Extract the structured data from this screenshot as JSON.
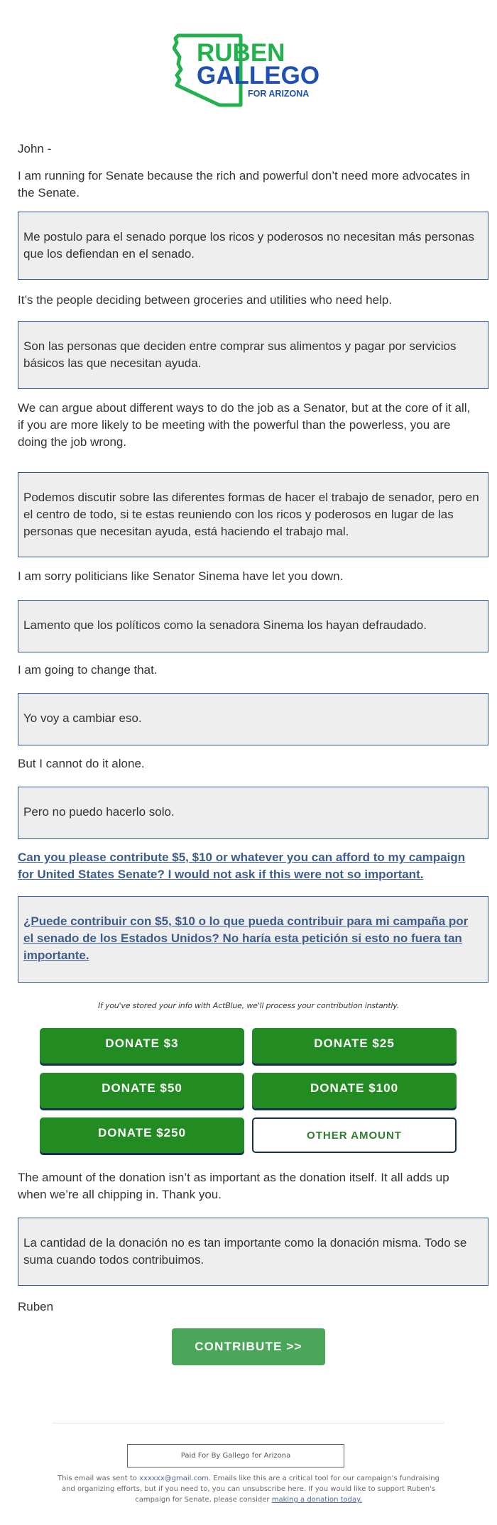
{
  "logo": {
    "line1": "RUBEN",
    "line2": "GALLEGO",
    "line3": "FOR ARIZONA",
    "icon": "arizona-outline-icon",
    "colors": {
      "green": "#22b14c",
      "blue": "#1f4fb3"
    }
  },
  "greeting": "John -",
  "paragraphs": [
    {
      "en": "I am running for Senate because the rich and powerful don’t need more advocates in the Senate.",
      "es": "Me postulo para el senado porque los ricos y poderosos no necesitan más personas que los defiendan en el senado."
    },
    {
      "en": "It’s the people deciding between groceries and utilities who need help.",
      "es": "Son las personas que deciden entre comprar sus alimentos y pagar por servicios básicos las que necesitan ayuda."
    },
    {
      "en": "We can argue about different ways to do the job as a Senator, but at the core of it all, if you are more likely to be meeting with the powerful than the powerless, you are doing the job wrong.",
      "es": "Podemos discutir sobre las diferentes formas de hacer el trabajo de senador, pero en el centro de todo, si te estas reuniendo con los ricos y poderosos en lugar de las personas que necesitan ayuda, está haciendo el trabajo mal."
    },
    {
      "en": "I am sorry politicians like Senator Sinema have let you down.",
      "es": "Lamento que los políticos como la senadora Sinema los hayan defraudado."
    },
    {
      "en": "I am going to change that.",
      "es": "Yo voy a cambiar eso."
    },
    {
      "en": "But I cannot do it alone.",
      "es": "Pero no puedo hacerlo solo."
    }
  ],
  "ask": {
    "en": "Can you please contribute $5, $10 or whatever you can afford to my campaign for United States Senate? I would not ask if this were not so important.",
    "es": "¿Puede contribuir con $5, $10 o lo que pueda contribuir para mi campaña por el senado de los Estados Unidos? No haría esta petición si esto no fuera tan importante."
  },
  "actblue_note": "If you've stored your info with ActBlue, we'll process your contribution instantly.",
  "donate_buttons": [
    {
      "label": "DONATE $3"
    },
    {
      "label": "DONATE $25"
    },
    {
      "label": "DONATE $50"
    },
    {
      "label": "DONATE $100"
    },
    {
      "label": "DONATE $250"
    },
    {
      "label": "OTHER AMOUNT"
    }
  ],
  "closing": {
    "en": "The amount of the donation isn’t as important as the donation itself. It all adds up when we’re all chipping in. Thank you.",
    "es": "La cantidad de la donación no es tan importante como la donación misma. Todo se suma cuando todos contribuimos."
  },
  "signature": "Ruben",
  "contribute_label": "CONTRIBUTE >>",
  "footer": {
    "paid_for": "Paid For By Gallego for Arizona",
    "text_before_email": "This email was sent to ",
    "email": "xxxxxx@gmail.com",
    "text_after_email": ". Emails like this are a critical tool for our campaign's fundraising and organizing efforts, but if you need to, you can unsubscribe here. If you would like to support Ruben's campaign for Senate, please consider ",
    "donation_link": "making a donation today."
  },
  "colors": {
    "donate_green": "#228b22",
    "contribute_green": "#4aa75a",
    "box_border": "#2b5797",
    "box_bg": "#eeeeee",
    "link": "#3d5c8e"
  }
}
